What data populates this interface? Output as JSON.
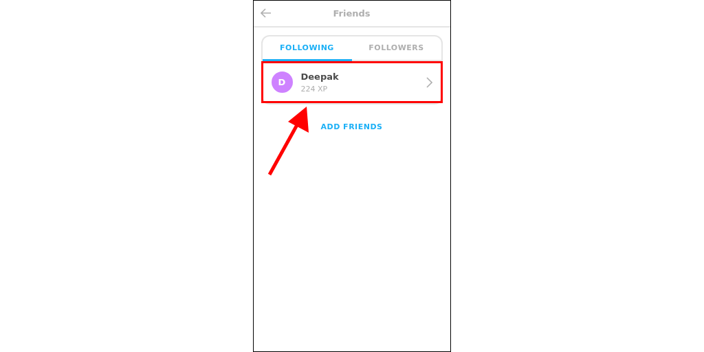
{
  "header": {
    "title": "Friends"
  },
  "tabs": [
    {
      "label": "FOLLOWING",
      "selected": true
    },
    {
      "label": "FOLLOWERS",
      "selected": false
    }
  ],
  "friends": [
    {
      "initial": "D",
      "name": "Deepak",
      "xp": "224 XP",
      "color": "#ce82ff",
      "highlighted": true
    }
  ],
  "add_friends": "ADD FRIENDS"
}
